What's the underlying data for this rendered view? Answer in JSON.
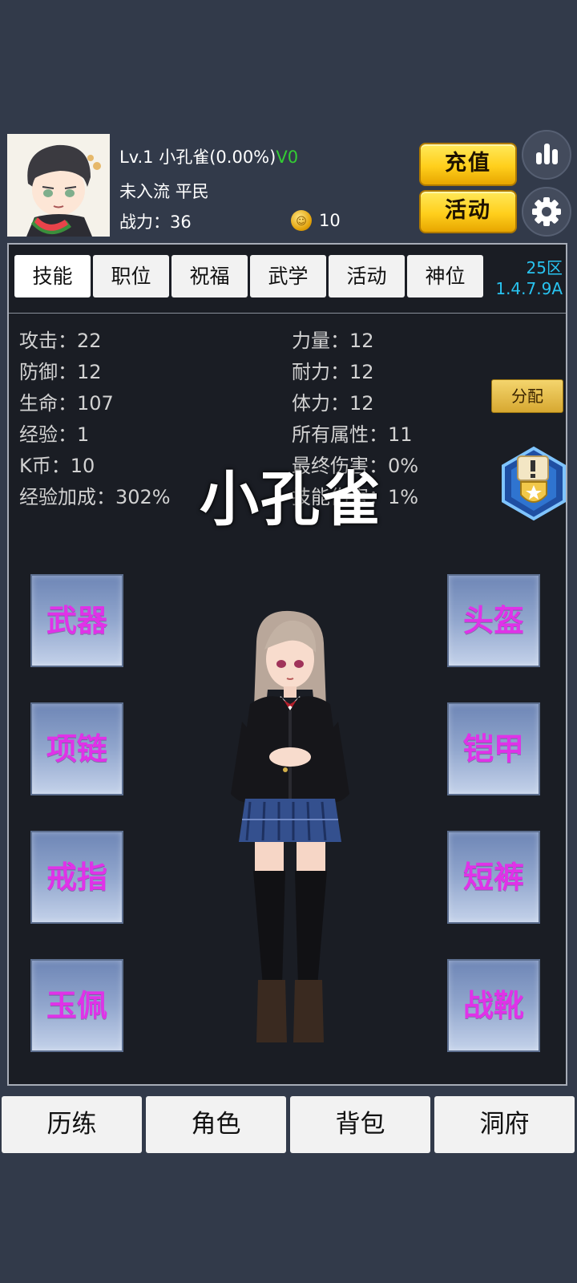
{
  "header": {
    "level": "Lv.1",
    "player_name": "小孔雀",
    "exp_percent": "(0.00%)",
    "vip": "V0",
    "realm": "未入流",
    "rank": "平民",
    "power_label": "战力：",
    "power_value": "36",
    "coins": "10",
    "recharge_label": "充值",
    "activity_label": "活动",
    "stats_icon": "bar-chart-icon",
    "settings_icon": "gear-icon"
  },
  "tabs": [
    "技能",
    "职位",
    "祝福",
    "武学",
    "活动",
    "神位"
  ],
  "server": {
    "zone": "25区",
    "version": "1.4.7.9A"
  },
  "stats": {
    "left": [
      {
        "label": "攻击：",
        "value": "22"
      },
      {
        "label": "防御：",
        "value": "12"
      },
      {
        "label": "生命：",
        "value": "107"
      },
      {
        "label": "经验：",
        "value": "1"
      },
      {
        "label": "K币：",
        "value": "10"
      },
      {
        "label": "经验加成：",
        "value": "302%"
      }
    ],
    "right": [
      {
        "label": "力量：",
        "value": "12"
      },
      {
        "label": "耐力：",
        "value": "12"
      },
      {
        "label": "体力：",
        "value": "12"
      },
      {
        "label": "所有属性：",
        "value": "11"
      },
      {
        "label": "最终伤害：",
        "value": "0%"
      },
      {
        "label": "技能伤害：",
        "value": "1%"
      }
    ],
    "distribute_label": "分配"
  },
  "overlay_title": "小孔雀",
  "equipment": {
    "left": [
      "武器",
      "项链",
      "戒指",
      "玉佩"
    ],
    "right": [
      "头盔",
      "铠甲",
      "短裤",
      "战靴"
    ]
  },
  "bottom_nav": [
    "历练",
    "角色",
    "背包",
    "洞府"
  ],
  "colors": {
    "background": "#323a4a",
    "panel": "#1a1d24",
    "slot_text": "#e032e8",
    "vip": "#33cc33",
    "version": "#28c3f0",
    "gold_button": "#ffd42a"
  }
}
